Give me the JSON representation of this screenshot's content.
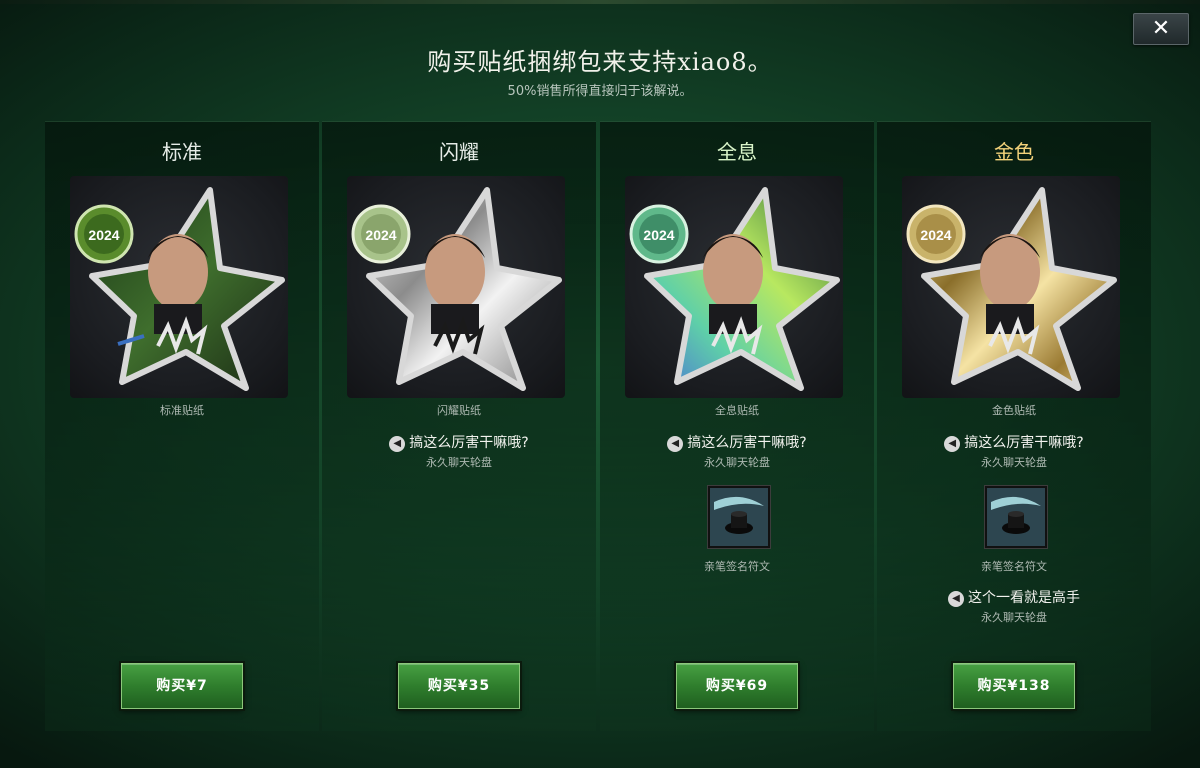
{
  "header": {
    "title": "购买贴纸捆绑包来支持xiao8。",
    "subtitle": "50%销售所得直接归于该解说。",
    "close_label": "✕"
  },
  "tiers": [
    {
      "name": "标准",
      "sticker_label": "标准贴纸",
      "badge_year": "2024",
      "finish": "standard",
      "buy_label": "购买¥7"
    },
    {
      "name": "闪耀",
      "sticker_label": "闪耀贴纸",
      "badge_year": "2024",
      "finish": "shiny",
      "chat_wheel_1": "搞这么厉害干嘛哦?",
      "chat_wheel_1_sub": "永久聊天轮盘",
      "buy_label": "购买¥35"
    },
    {
      "name": "全息",
      "sticker_label": "全息贴纸",
      "badge_year": "2024",
      "finish": "holo",
      "chat_wheel_1": "搞这么厉害干嘛哦?",
      "chat_wheel_1_sub": "永久聊天轮盘",
      "rune_label": "亲笔签名符文",
      "buy_label": "购买¥69"
    },
    {
      "name": "金色",
      "sticker_label": "金色贴纸",
      "badge_year": "2024",
      "finish": "gold",
      "chat_wheel_1": "搞这么厉害干嘛哦?",
      "chat_wheel_1_sub": "永久聊天轮盘",
      "rune_label": "亲笔签名符文",
      "chat_wheel_2": "这个一看就是高手",
      "chat_wheel_2_sub": "永久聊天轮盘",
      "buy_label": "购买¥138"
    }
  ],
  "icons": {
    "speaker": "speaker-icon",
    "close": "close-icon"
  },
  "colors": {
    "buy_button": "#2f7e2d",
    "gold_title": "#f3d27a"
  }
}
